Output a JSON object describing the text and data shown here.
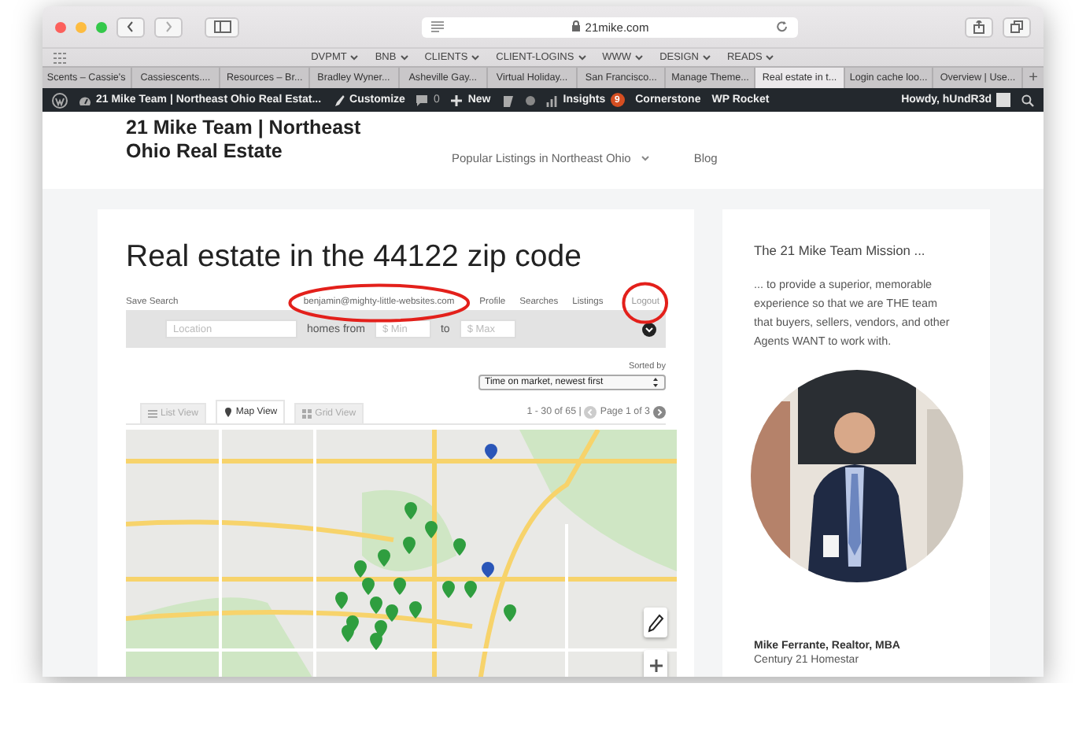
{
  "browser": {
    "url": "21mike.com",
    "bookmarks": [
      {
        "label": "DVPMT"
      },
      {
        "label": "BNB"
      },
      {
        "label": "CLIENTS"
      },
      {
        "label": "CLIENT-LOGINS"
      },
      {
        "label": "WWW"
      },
      {
        "label": "DESIGN"
      },
      {
        "label": "READS"
      }
    ],
    "tabs": [
      {
        "label": "Scents – Cassie's",
        "selected": false
      },
      {
        "label": "Cassiescents....",
        "selected": false
      },
      {
        "label": "Resources – Br...",
        "selected": false
      },
      {
        "label": "Bradley Wyner...",
        "selected": false
      },
      {
        "label": "Asheville Gay...",
        "selected": false
      },
      {
        "label": "Virtual Holiday...",
        "selected": false
      },
      {
        "label": "San Francisco...",
        "selected": false
      },
      {
        "label": "Manage Theme...",
        "selected": false
      },
      {
        "label": "Real estate in t...",
        "selected": true
      },
      {
        "label": "Login cache loo...",
        "selected": false
      },
      {
        "label": "Overview | Use...",
        "selected": false
      }
    ],
    "new_tab": "+"
  },
  "admin_bar": {
    "site": "21 Mike Team | Northeast Ohio Real Estat...",
    "customize": "Customize",
    "comments": "0",
    "new": "New",
    "insights": "Insights",
    "insights_badge": "9",
    "items": [
      "Cornerstone",
      "WP Rocket"
    ],
    "greeting": "Howdy, hUndR3d"
  },
  "site_header": {
    "title": "21 Mike Team | Northeast Ohio Real Estate",
    "nav": [
      {
        "label": "Popular Listings in Northeast Ohio",
        "has_submenu": true
      },
      {
        "label": "Blog",
        "has_submenu": false
      }
    ]
  },
  "listings": {
    "title": "Real estate in the 44122 zip code",
    "save_search": "Save Search",
    "account": [
      "benjamin@mighty-little-websites.com",
      "Profile",
      "Searches",
      "Listings",
      "Logout"
    ],
    "search": {
      "location_placeholder": "Location",
      "from_label": "homes from",
      "min_placeholder": "$ Min",
      "to_label": "to",
      "max_placeholder": "$ Max"
    },
    "sort": {
      "label": "Sorted by",
      "value": "Time on market, newest first"
    },
    "views": [
      {
        "label": "List View",
        "selected": false
      },
      {
        "label": "Map View",
        "selected": true
      },
      {
        "label": "Grid View",
        "selected": false
      }
    ],
    "count": "1 - 30 of 65 |",
    "page": "Page 1 of 3",
    "annotations": [
      {
        "kind": "ellipse"
      },
      {
        "kind": "ellipse"
      }
    ]
  },
  "sidebar": {
    "heading": "The 21 Mike Team Mission ...",
    "text": "... to provide a superior, memorable experience so that we are THE team that buyers, sellers, vendors, and other Agents WANT to work with.",
    "name": "Mike Ferrante, Realtor, MBA",
    "company": "Century 21 Homestar"
  }
}
